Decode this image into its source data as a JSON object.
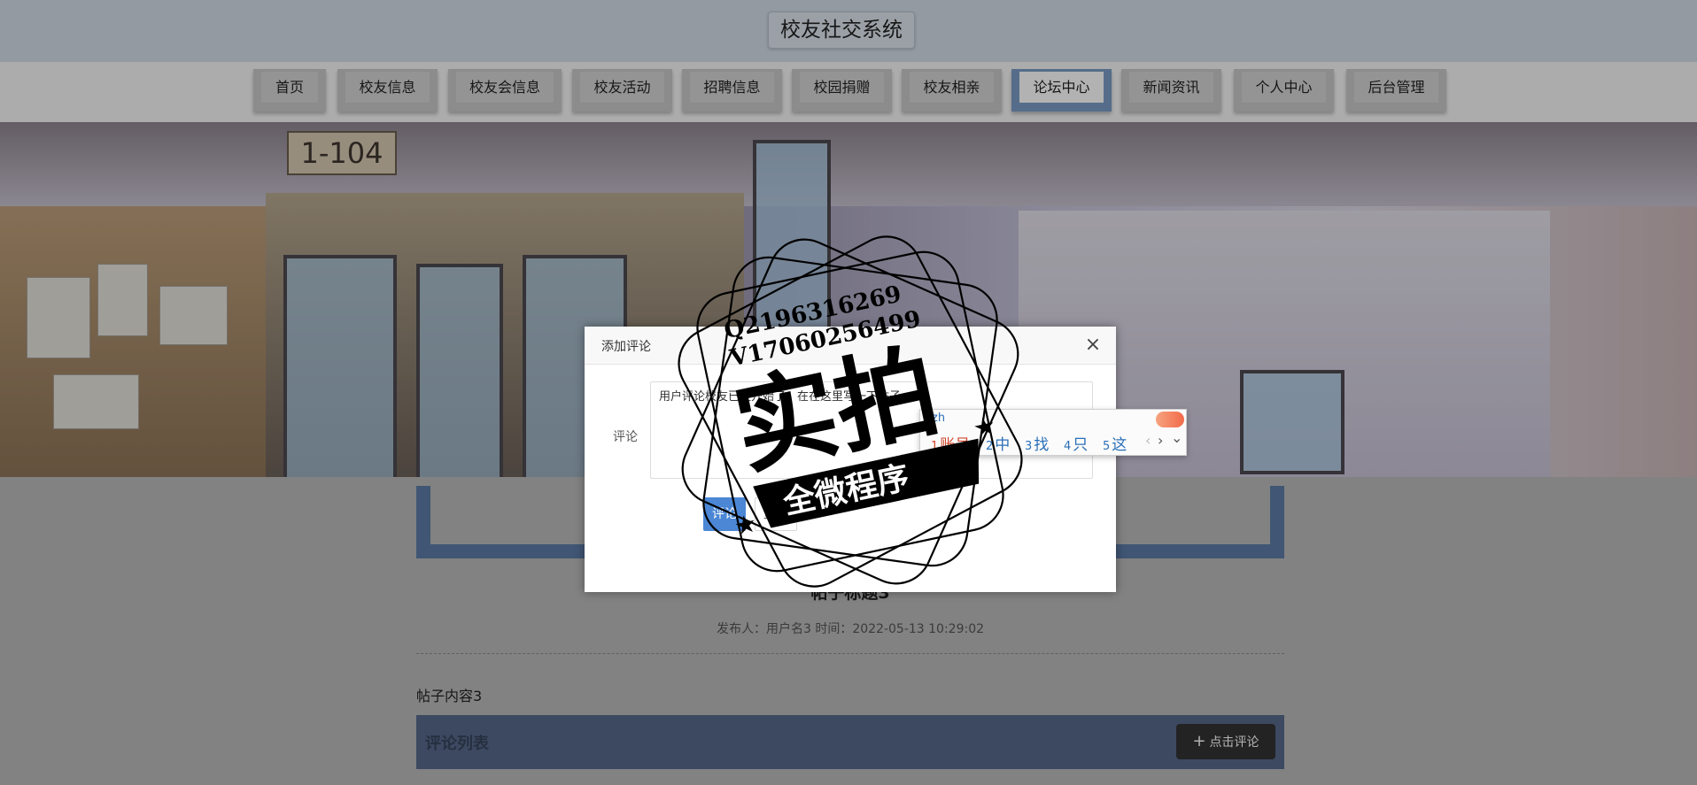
{
  "header": {
    "title": "校友社交系统"
  },
  "nav": {
    "items": [
      {
        "label": "首页"
      },
      {
        "label": "校友信息"
      },
      {
        "label": "校友会信息"
      },
      {
        "label": "校友活动"
      },
      {
        "label": "招聘信息"
      },
      {
        "label": "校园捐赠"
      },
      {
        "label": "校友相亲"
      },
      {
        "label": "论坛中心"
      },
      {
        "label": "新闻资讯"
      },
      {
        "label": "个人中心"
      },
      {
        "label": "后台管理"
      }
    ],
    "active_index": 7,
    "active_color": "#7a9cc6"
  },
  "banner": {
    "room_sign": "1-104"
  },
  "post": {
    "title": "帖子标题3",
    "meta": "发布人：用户名3 时间：2022-05-13 10:29:02",
    "content": "帖子内容3"
  },
  "comments": {
    "section_title": "评论列表",
    "add_button_label": "点击评论",
    "bar_color": "#56698c"
  },
  "modal": {
    "title": "添加评论",
    "field_label": "评论",
    "textarea_value": "用户评论校友已经开始了，在在这里写一下帖子",
    "submit_label": "评论",
    "reset_label": "重置",
    "close_icon": "close-icon"
  },
  "ime": {
    "top_text": "zh",
    "candidates": [
      {
        "num": "1",
        "text": "账号"
      },
      {
        "num": "2",
        "text": "中"
      },
      {
        "num": "3",
        "text": "找"
      },
      {
        "num": "4",
        "text": "只"
      },
      {
        "num": "5",
        "text": "这"
      }
    ],
    "prev": "‹",
    "next": "›",
    "expand": "⌄"
  },
  "watermark": {
    "line1": "Q2196316269",
    "line2": "V17060256499",
    "main": "实拍",
    "ribbon": "全微程序"
  }
}
